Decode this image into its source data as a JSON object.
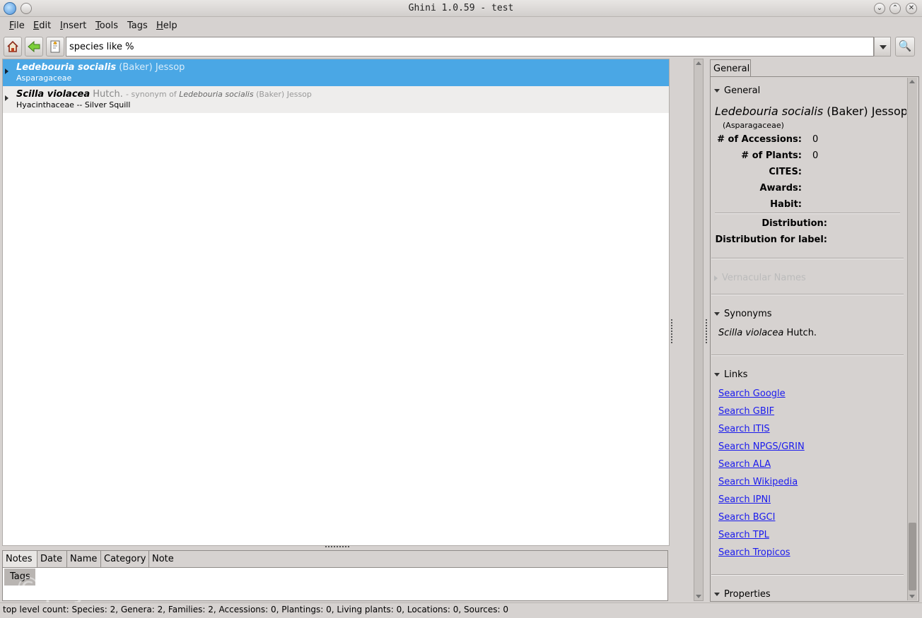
{
  "window": {
    "title": "Ghini 1.0.59 - test"
  },
  "menu": [
    {
      "label": "File",
      "key": "F",
      "rest": "ile"
    },
    {
      "label": "Edit",
      "key": "E",
      "rest": "dit"
    },
    {
      "label": "Insert",
      "key": "I",
      "rest": "nsert"
    },
    {
      "label": "Tools",
      "key": "T",
      "rest": "ools"
    },
    {
      "label": "Tags",
      "key": "",
      "rest": "Tags"
    },
    {
      "label": "Help",
      "key": "H",
      "rest": "elp"
    }
  ],
  "search": {
    "value": "species like %"
  },
  "results": [
    {
      "species": "Ledebouria socialis",
      "author": "(Baker) Jessop",
      "synonym_prefix": "",
      "synonym_species": "",
      "synonym_author": "",
      "family": "Asparagaceae"
    },
    {
      "species": "Scilla violacea",
      "author": "Hutch.",
      "synonym_prefix": "- synonym of",
      "synonym_species": "Ledebouria socialis",
      "synonym_author": "(Baker) Jessop",
      "family": "Hyacinthaceae -- Silver Squill"
    }
  ],
  "notes": {
    "tab_label": "Notes",
    "columns": [
      "Date",
      "Name",
      "Category",
      "Note"
    ],
    "tags_tab": "Tags"
  },
  "info": {
    "tab": "General",
    "general": {
      "header": "General",
      "name_species": "Ledebouria socialis",
      "name_author": "(Baker) Jessop",
      "family": "(Asparagaceae)",
      "accessions_label": "# of Accessions:",
      "accessions_value": "0",
      "plants_label": "# of Plants:",
      "plants_value": "0",
      "cites_label": "CITES:",
      "awards_label": "Awards:",
      "habit_label": "Habit:",
      "distribution_label": "Distribution:",
      "distribution_label_label": "Distribution for label:"
    },
    "vernacular": {
      "header": "Vernacular Names"
    },
    "synonyms": {
      "header": "Synonyms",
      "species": "Scilla violacea",
      "author": "Hutch."
    },
    "links": {
      "header": "Links",
      "items": [
        "Search Google",
        "Search GBIF",
        "Search ITIS",
        "Search NPGS/GRIN",
        "Search ALA",
        "Search Wikipedia",
        "Search IPNI",
        "Search BGCI",
        "Search TPL",
        "Search Tropicos"
      ]
    },
    "properties": {
      "header": "Properties"
    }
  },
  "status": "top level count: Species: 2, Genera: 2, Families: 2, Accessions: 0, Plantings: 0, Living plants: 0, Locations: 0, Sources: 0",
  "watermark": "©ply.me.uk"
}
